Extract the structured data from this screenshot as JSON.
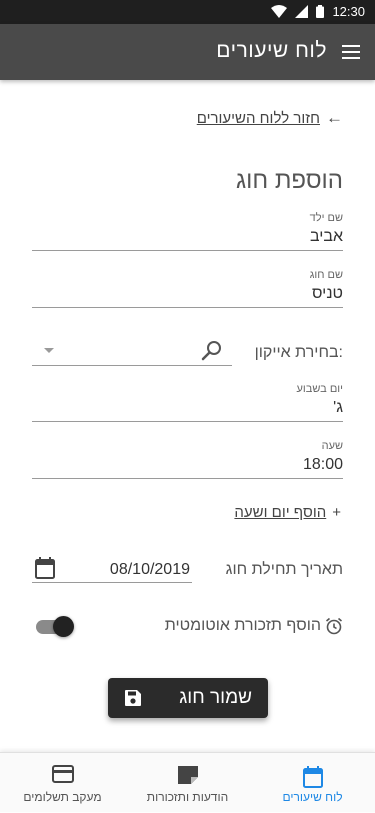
{
  "status": {
    "time": "12:30"
  },
  "appbar": {
    "title": "לוח שיעורים",
    "menu_icon": "menu-icon"
  },
  "back": {
    "label": "חזור ללוח השיעורים",
    "arrow": "←"
  },
  "page": {
    "title": "הוספת חוג"
  },
  "form": {
    "child_name": {
      "label": "שם ילד",
      "value": "אביב"
    },
    "class_name": {
      "label": "שם חוג",
      "value": "טניס"
    },
    "icon_choice": {
      "label": "בחירת אייקון:"
    },
    "weekday": {
      "label": "יום בשבוע",
      "value": "ג'"
    },
    "time": {
      "label": "שעה",
      "value": "18:00"
    },
    "add_day": {
      "plus": "+",
      "label": "הוסף יום ושעה"
    },
    "start_date": {
      "label": "תאריך תחילת חוג",
      "value": "08/10/2019"
    },
    "reminder": {
      "label": "הוסף תזכורת אוטומטית",
      "enabled": true
    }
  },
  "save_button": {
    "label": "שמור חוג"
  },
  "bottom_nav": [
    {
      "label": "לוח שיעורים",
      "icon": "calendar-icon",
      "active": true
    },
    {
      "label": "הודעות ותזכורות",
      "icon": "note-icon",
      "active": false
    },
    {
      "label": "מעקב תשלומים",
      "icon": "credit-card-icon",
      "active": false
    }
  ],
  "colors": {
    "appbar": "#4a4a4a",
    "statusbar": "#1f1f1f",
    "accent": "#1e88e5",
    "button": "#2b2b2b"
  }
}
